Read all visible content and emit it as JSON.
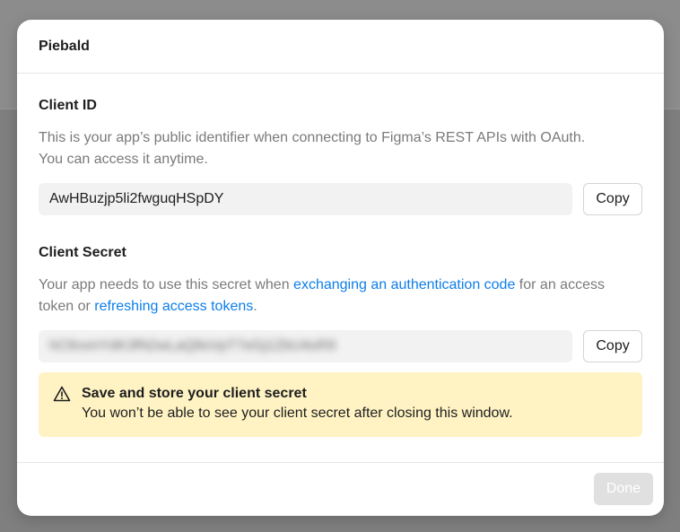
{
  "modal": {
    "title": "Piebald"
  },
  "client_id": {
    "heading": "Client ID",
    "description": "This is your app’s public identifier when connecting to Figma’s REST APIs with OAuth. You can access it anytime.",
    "value": "AwHBuzjp5li2fwguqHSpDY",
    "copy_label": "Copy"
  },
  "client_secret": {
    "heading": "Client Secret",
    "description_prefix": "Your app needs to use this secret when ",
    "link1": "exchanging an authentication code",
    "description_middle": " for an access token or ",
    "link2": "refreshing access tokens",
    "description_suffix": ".",
    "value_masked": "hC6rxmYdK3fN2wLaQ8sVpT7eGj1ZbU4oR9",
    "copy_label": "Copy"
  },
  "warning": {
    "icon": "warning-triangle-icon",
    "title": "Save and store your client secret",
    "text": "You won’t be able to see your client secret after closing this window."
  },
  "footer": {
    "done_label": "Done"
  },
  "colors": {
    "link": "#0d7ee8",
    "warning_bg": "#fff3c4",
    "disabled_button": "#e0e0e0"
  }
}
